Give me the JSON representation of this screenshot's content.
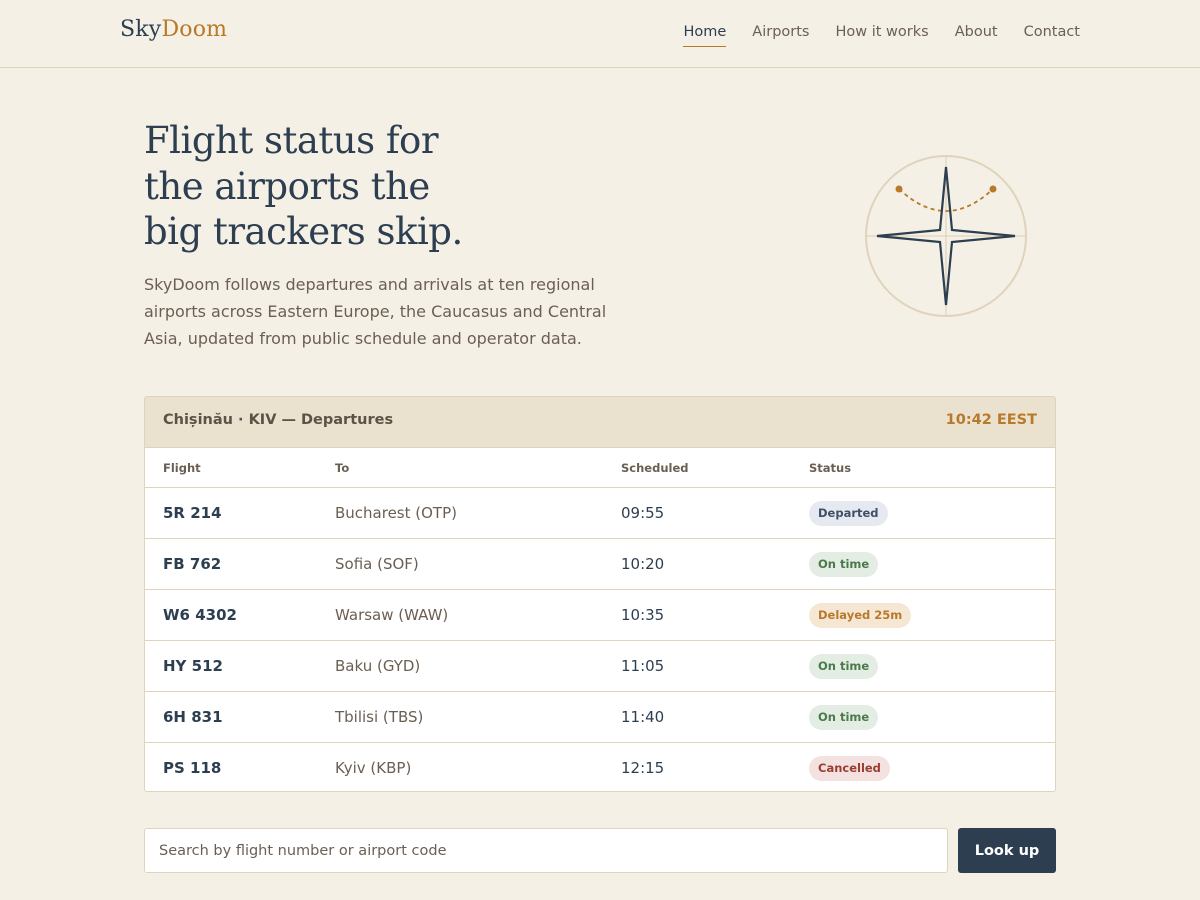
{
  "brand": {
    "part1": "Sky",
    "part2": "Doom"
  },
  "nav": {
    "items": [
      {
        "label": "Home",
        "active": true
      },
      {
        "label": "Airports"
      },
      {
        "label": "How it works"
      },
      {
        "label": "About"
      },
      {
        "label": "Contact"
      }
    ]
  },
  "hero": {
    "title_lines": [
      "Flight status for",
      "the airports the",
      "big trackers skip."
    ],
    "subtitle": "SkyDoom follows departures and arrivals at ten regional airports across Eastern Europe, the Caucasus and Central Asia, updated from public schedule and operator data."
  },
  "board": {
    "title": "Chișinău · KIV — Departures",
    "time": "10:42 EEST",
    "columns": {
      "flight": "Flight",
      "to": "To",
      "scheduled": "Scheduled",
      "status": "Status"
    },
    "rows": [
      {
        "flight": "5R 214",
        "to": "Bucharest (OTP)",
        "scheduled": "09:55",
        "status": "Departed"
      },
      {
        "flight": "FB 762",
        "to": "Sofia (SOF)",
        "scheduled": "10:20",
        "status": "On time"
      },
      {
        "flight": "W6 4302",
        "to": "Warsaw (WAW)",
        "scheduled": "10:35",
        "status": "Delayed 25m"
      },
      {
        "flight": "HY 512",
        "to": "Baku (GYD)",
        "scheduled": "11:05",
        "status": "On time"
      },
      {
        "flight": "6H 831",
        "to": "Tbilisi (TBS)",
        "scheduled": "11:40",
        "status": "On time"
      },
      {
        "flight": "PS 118",
        "to": "Kyiv (KBP)",
        "scheduled": "12:15",
        "status": "Cancelled"
      }
    ]
  },
  "search": {
    "placeholder": "Search by flight number or airport code",
    "value": "",
    "button_label": "Look up"
  },
  "colors": {
    "background": "#f5f0e6",
    "navy": "#2c3e50",
    "accent": "#b8792a",
    "border": "#e0d3bc",
    "board_header": "#ebe1cf",
    "status_departed": "#3d5068",
    "status_on_time": "#4a7a4a",
    "status_delayed": "#b8792a",
    "status_cancelled": "#9b3d33"
  },
  "icons": {
    "hero_art": "compass-star-icon"
  }
}
